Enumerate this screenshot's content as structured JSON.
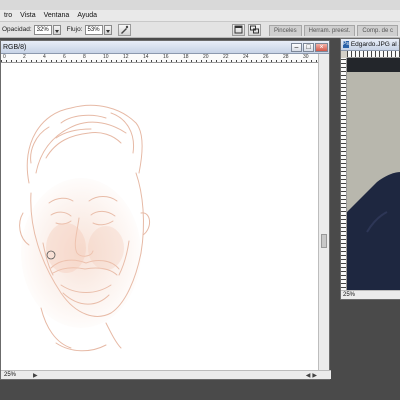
{
  "menu": {
    "items": [
      "tro",
      "Vista",
      "Ventana",
      "Ayuda"
    ]
  },
  "options": {
    "opacity_label": "Opacidad:",
    "opacity_value": "32%",
    "flow_label": "Flujo:",
    "flow_value": "53%"
  },
  "tabs": [
    "Pinceles",
    "Herram. preest.",
    "Comp. de c"
  ],
  "doc1": {
    "title": "RGB/8)",
    "zoom": "25%",
    "ruler_labels": [
      "0",
      "2",
      "4",
      "6",
      "8",
      "10",
      "12",
      "14",
      "16",
      "18",
      "20",
      "22",
      "24",
      "26",
      "28",
      "30"
    ]
  },
  "doc2": {
    "title": "Edgardo.JPG al 25%",
    "zoom": "25%"
  },
  "colors": {
    "sketch": "#e8b8a4",
    "canvas": "#ffffff",
    "background": "#4a4a4a",
    "suit": "#1e2740"
  }
}
